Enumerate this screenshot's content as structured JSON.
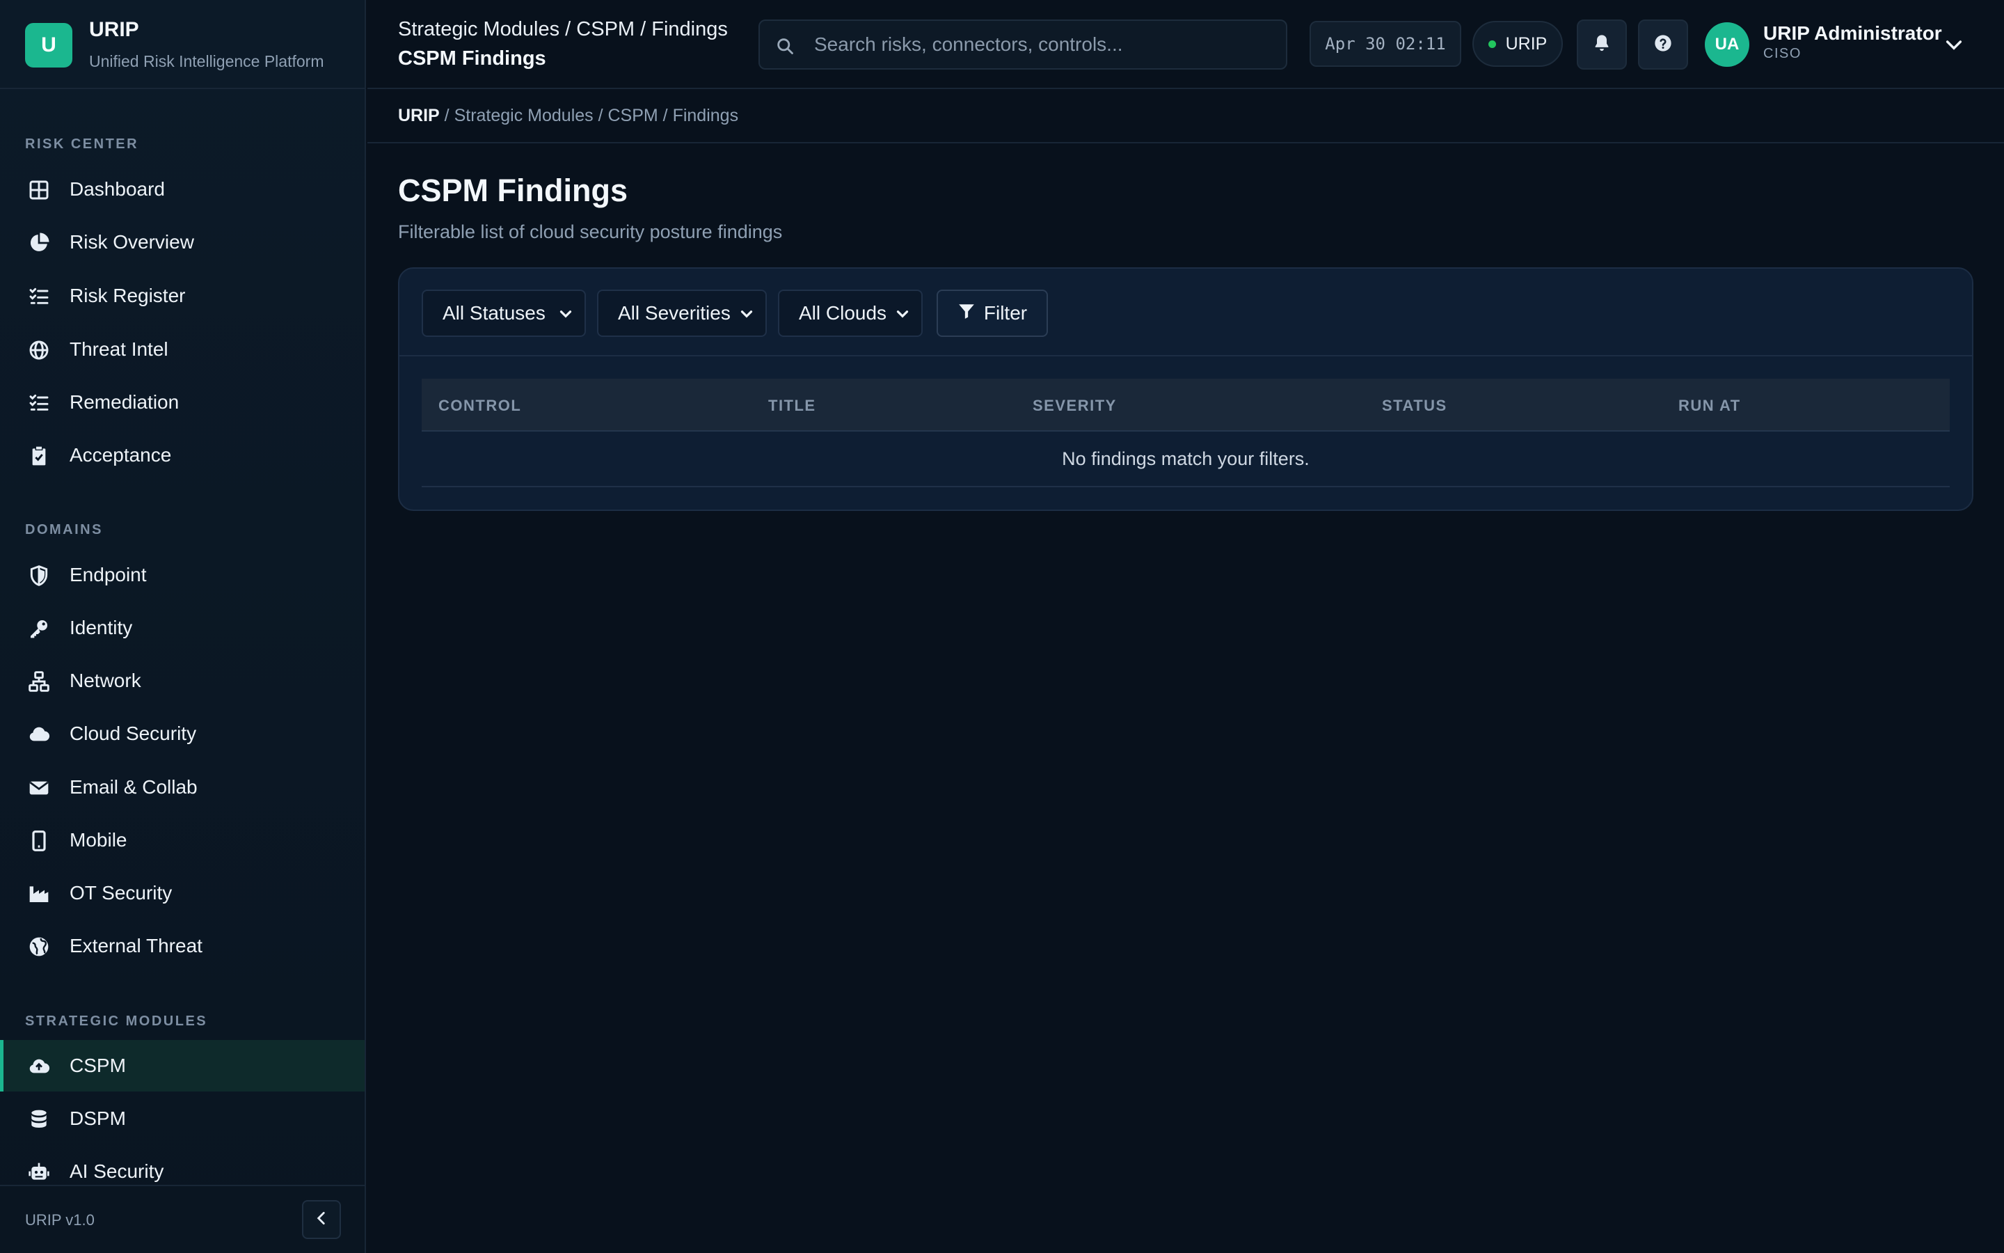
{
  "brand": {
    "logo_letter": "U",
    "name": "URIP",
    "subtitle": "Unified Risk Intelligence Platform"
  },
  "sidebar": {
    "sections": [
      {
        "label": "RISK CENTER",
        "items": [
          {
            "label": "Dashboard",
            "icon": "grid-icon"
          },
          {
            "label": "Risk Overview",
            "icon": "pie-chart-icon"
          },
          {
            "label": "Risk Register",
            "icon": "list-check-icon"
          },
          {
            "label": "Threat Intel",
            "icon": "globe-icon"
          },
          {
            "label": "Remediation",
            "icon": "list-check-icon"
          },
          {
            "label": "Acceptance",
            "icon": "clipboard-check-icon"
          }
        ]
      },
      {
        "label": "DOMAINS",
        "items": [
          {
            "label": "Endpoint",
            "icon": "shield-icon"
          },
          {
            "label": "Identity",
            "icon": "key-icon"
          },
          {
            "label": "Network",
            "icon": "network-icon"
          },
          {
            "label": "Cloud Security",
            "icon": "cloud-icon"
          },
          {
            "label": "Email & Collab",
            "icon": "envelope-icon"
          },
          {
            "label": "Mobile",
            "icon": "mobile-icon"
          },
          {
            "label": "OT Security",
            "icon": "factory-icon"
          },
          {
            "label": "External Threat",
            "icon": "globe-alt-icon"
          }
        ]
      },
      {
        "label": "STRATEGIC MODULES",
        "items": [
          {
            "label": "CSPM",
            "icon": "cloud-upload-icon",
            "active": true
          },
          {
            "label": "DSPM",
            "icon": "database-icon"
          },
          {
            "label": "AI Security",
            "icon": "robot-icon"
          }
        ]
      }
    ],
    "version": "URIP v1.0"
  },
  "topbar": {
    "breadcrumb": "Strategic Modules / CSPM / Findings",
    "title": "CSPM Findings",
    "search_placeholder": "Search risks, connectors, controls...",
    "datetime": "Apr 30 02:11",
    "tenant": "URIP",
    "user": {
      "initials": "UA",
      "name": "URIP Administrator",
      "role": "CISO"
    }
  },
  "breadcrumb": {
    "root": "URIP",
    "rest": " / Strategic Modules / CSPM / Findings"
  },
  "page": {
    "title": "CSPM Findings",
    "subtitle": "Filterable list of cloud security posture findings"
  },
  "filters": {
    "status": "All Statuses",
    "severity": "All Severities",
    "cloud": "All Clouds",
    "button": "Filter"
  },
  "table": {
    "columns": [
      "CONTROL",
      "TITLE",
      "SEVERITY",
      "STATUS",
      "RUN AT"
    ],
    "empty_message": "No findings match your filters."
  },
  "colors": {
    "accent": "#1bb78f",
    "background": "#08111c",
    "card": "#0e1e33",
    "online": "#22c55e"
  }
}
